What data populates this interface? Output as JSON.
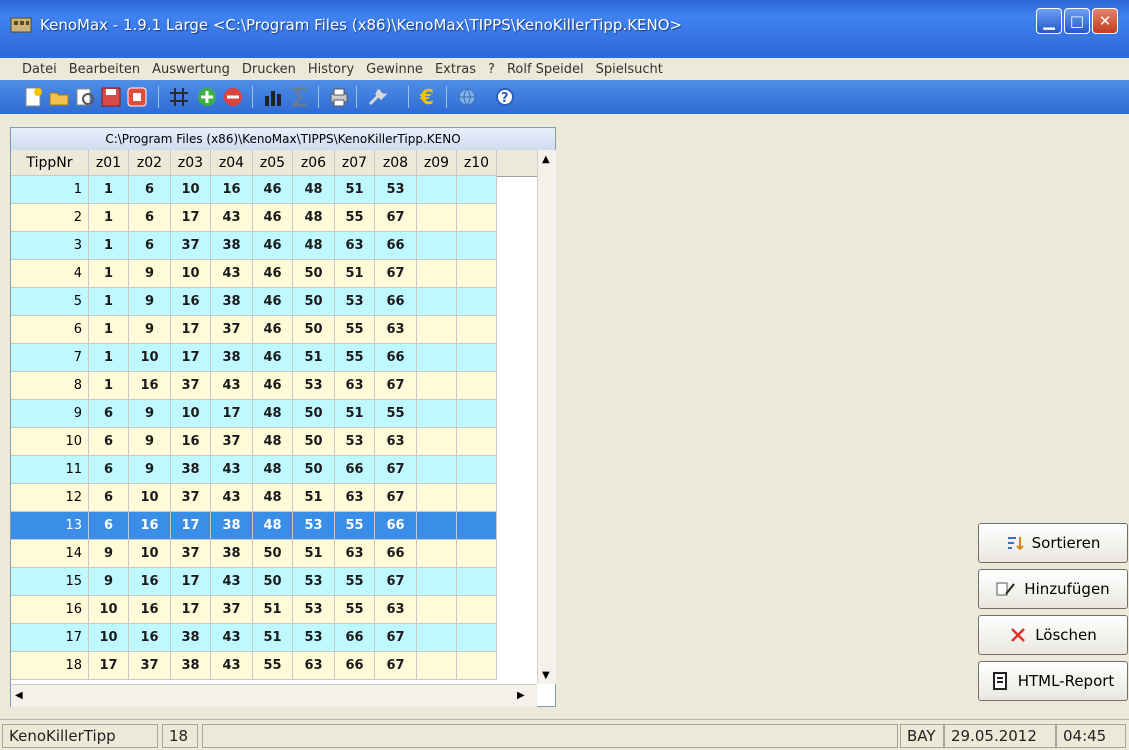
{
  "window": {
    "title": "KenoMax - 1.9.1 Large  <C:\\Program Files (x86)\\KenoMax\\TIPPS\\KenoKillerTipp.KENO>",
    "min_glyph": "▁",
    "max_glyph": "□",
    "close_glyph": "✕"
  },
  "menu": [
    "Datei",
    "Bearbeiten",
    "Auswertung",
    "Drucken",
    "History",
    "Gewinne",
    "Extras",
    "?",
    "Rolf Speidel",
    "Spielsucht"
  ],
  "toolbar": {
    "icons": [
      "new-icon",
      "open-icon",
      "print-preview-icon",
      "save-icon",
      "stop-icon",
      "grid-icon",
      "add-icon",
      "remove-icon",
      "chart-icon",
      "sum-icon",
      "printer-icon",
      "wrench-icon",
      "euro-icon",
      "globe-icon",
      "help-icon"
    ]
  },
  "grid": {
    "caption": "C:\\Program Files (x86)\\KenoMax\\TIPPS\\KenoKillerTipp.KENO",
    "headers": [
      "TippNr",
      "z01",
      "z02",
      "z03",
      "z04",
      "z05",
      "z06",
      "z07",
      "z08",
      "z09",
      "z10"
    ],
    "rows": [
      [
        "1",
        "1",
        "6",
        "10",
        "16",
        "46",
        "48",
        "51",
        "53",
        "",
        ""
      ],
      [
        "2",
        "1",
        "6",
        "17",
        "43",
        "46",
        "48",
        "55",
        "67",
        "",
        ""
      ],
      [
        "3",
        "1",
        "6",
        "37",
        "38",
        "46",
        "48",
        "63",
        "66",
        "",
        ""
      ],
      [
        "4",
        "1",
        "9",
        "10",
        "43",
        "46",
        "50",
        "51",
        "67",
        "",
        ""
      ],
      [
        "5",
        "1",
        "9",
        "16",
        "38",
        "46",
        "50",
        "53",
        "66",
        "",
        ""
      ],
      [
        "6",
        "1",
        "9",
        "17",
        "37",
        "46",
        "50",
        "55",
        "63",
        "",
        ""
      ],
      [
        "7",
        "1",
        "10",
        "17",
        "38",
        "46",
        "51",
        "55",
        "66",
        "",
        ""
      ],
      [
        "8",
        "1",
        "16",
        "37",
        "43",
        "46",
        "53",
        "63",
        "67",
        "",
        ""
      ],
      [
        "9",
        "6",
        "9",
        "10",
        "17",
        "48",
        "50",
        "51",
        "55",
        "",
        ""
      ],
      [
        "10",
        "6",
        "9",
        "16",
        "37",
        "48",
        "50",
        "53",
        "63",
        "",
        ""
      ],
      [
        "11",
        "6",
        "9",
        "38",
        "43",
        "48",
        "50",
        "66",
        "67",
        "",
        ""
      ],
      [
        "12",
        "6",
        "10",
        "37",
        "43",
        "48",
        "51",
        "63",
        "67",
        "",
        ""
      ],
      [
        "13",
        "6",
        "16",
        "17",
        "38",
        "48",
        "53",
        "55",
        "66",
        "",
        ""
      ],
      [
        "14",
        "9",
        "10",
        "37",
        "38",
        "50",
        "51",
        "63",
        "66",
        "",
        ""
      ],
      [
        "15",
        "9",
        "16",
        "17",
        "43",
        "50",
        "53",
        "55",
        "67",
        "",
        ""
      ],
      [
        "16",
        "10",
        "16",
        "17",
        "37",
        "51",
        "53",
        "55",
        "63",
        "",
        ""
      ],
      [
        "17",
        "10",
        "16",
        "38",
        "43",
        "51",
        "53",
        "66",
        "67",
        "",
        ""
      ],
      [
        "18",
        "17",
        "37",
        "38",
        "43",
        "55",
        "63",
        "66",
        "67",
        "",
        ""
      ]
    ],
    "selected_row": 13,
    "colors": {
      "cyan_row": "#bff8ff",
      "cream_row": "#fffbd9",
      "selected_row": "#3a8ee8"
    }
  },
  "buttons": {
    "sort": "Sortieren",
    "add": "Hinzufügen",
    "delete": "Löschen",
    "report": "HTML-Report"
  },
  "status": {
    "name": "KenoKillerTipp",
    "count": "18",
    "region": "BAY",
    "date": "29.05.2012",
    "time": "04:45"
  }
}
